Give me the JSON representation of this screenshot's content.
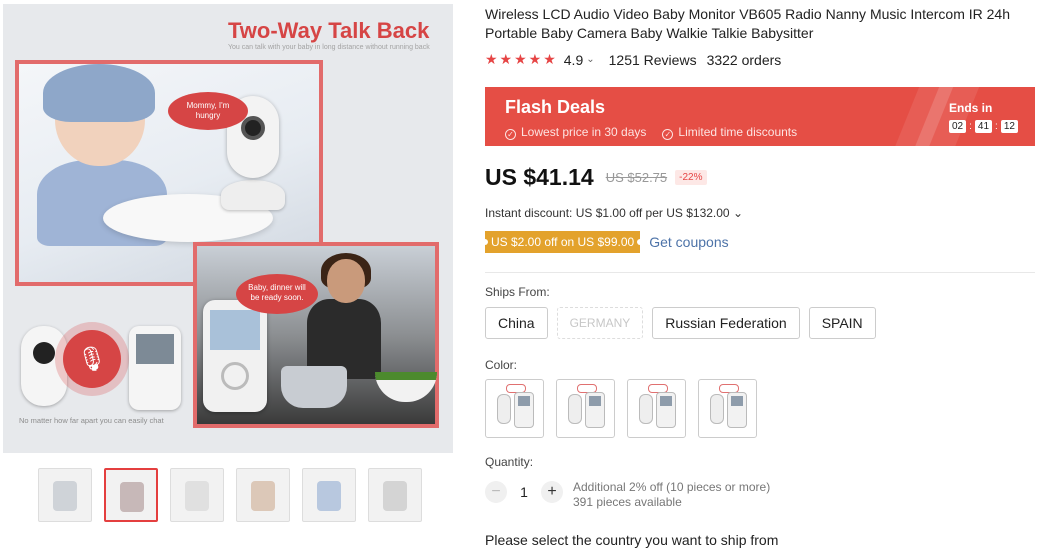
{
  "gallery": {
    "hero_title": "Two-Way Talk Back",
    "hero_subtitle": "You can talk with your baby in long distance without running back",
    "bubble_1": "Mommy, I'm hungry",
    "bubble_2": "Baby, dinner will be ready soon.",
    "caption": "No matter how far apart you can easily chat",
    "thumbnail_count": 6,
    "active_thumbnail": 2
  },
  "product": {
    "title": "Wireless LCD Audio Video Baby Monitor VB605 Radio Nanny Music Intercom IR 24h Portable Baby Camera Baby Walkie Talkie Babysitter",
    "stars": "★★★★★",
    "rating": "4.9",
    "rating_caret": "⌄",
    "reviews": "1251 Reviews",
    "orders": "3322 orders"
  },
  "flash": {
    "title": "Flash Deals",
    "tag_1": "Lowest price in 30 days",
    "tag_2": "Limited time discounts",
    "ends_label": "Ends in",
    "hours": "02",
    "minutes": "41",
    "seconds": "12",
    "sep": ":",
    "check_icon": "✓",
    "color": "#e54e45"
  },
  "pricing": {
    "price": "US $41.14",
    "old_price": "US $52.75",
    "discount": "-22%",
    "instant_discount": "Instant discount: US $1.00 off per US $132.00 ⌄",
    "coupon": "US $2.00 off on US $99.00",
    "get_coupons": "Get coupons"
  },
  "shipping": {
    "label": "Ships From:",
    "options": [
      {
        "label": "China"
      },
      {
        "label": "GERMANY"
      },
      {
        "label": "Russian Federation"
      },
      {
        "label": "SPAIN"
      }
    ]
  },
  "color": {
    "label": "Color:",
    "swatch_count": 4
  },
  "quantity": {
    "label": "Quantity:",
    "minus": "−",
    "value": "1",
    "plus": "+",
    "additional": "Additional 2% off (10 pieces or more)",
    "available": "391 pieces available"
  },
  "note": "Please select the country you want to ship from"
}
